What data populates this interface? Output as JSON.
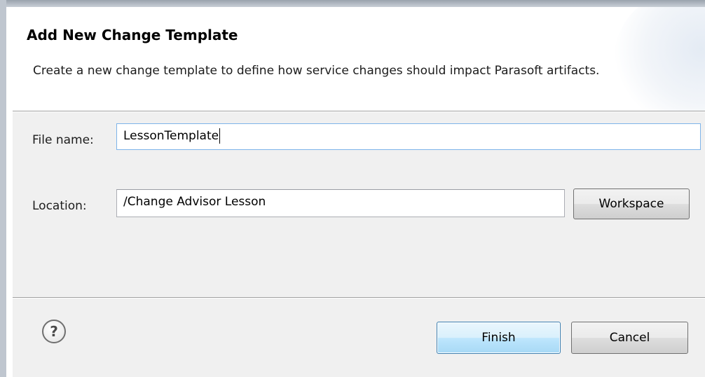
{
  "dialog": {
    "title": "Add New Change Template",
    "description": "Create a new change template to define how service changes should impact Parasoft artifacts."
  },
  "form": {
    "file_name_label": "File name:",
    "file_name_value": "LessonTemplate",
    "location_label": "Location:",
    "location_value": "/Change Advisor Lesson",
    "workspace_button": "Workspace"
  },
  "footer": {
    "help_glyph": "?",
    "help_icon": "help-icon",
    "finish_button": "Finish",
    "cancel_button": "Cancel"
  },
  "colors": {
    "focus_border": "#7eb4ea",
    "default_button": "#bee6fd"
  }
}
